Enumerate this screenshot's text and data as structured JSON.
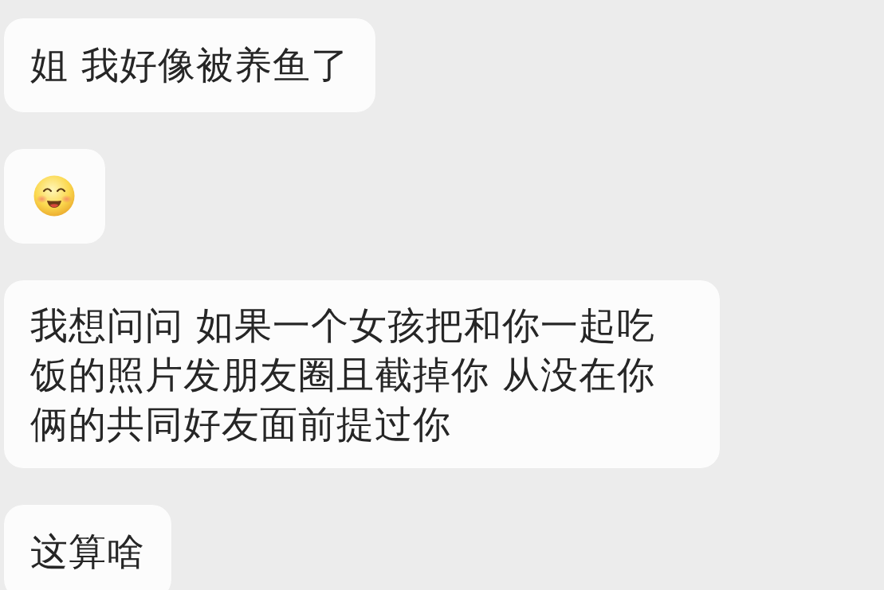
{
  "messages": [
    {
      "kind": "text",
      "text": "姐 我好像被养鱼了"
    },
    {
      "kind": "emoji"
    },
    {
      "kind": "text",
      "text": "我想问问 如果一个女孩把和你一起吃饭的照片发朋友圈且截掉你 从没在你俩的共同好友面前提过你"
    },
    {
      "kind": "text",
      "text": "这算啥"
    }
  ]
}
